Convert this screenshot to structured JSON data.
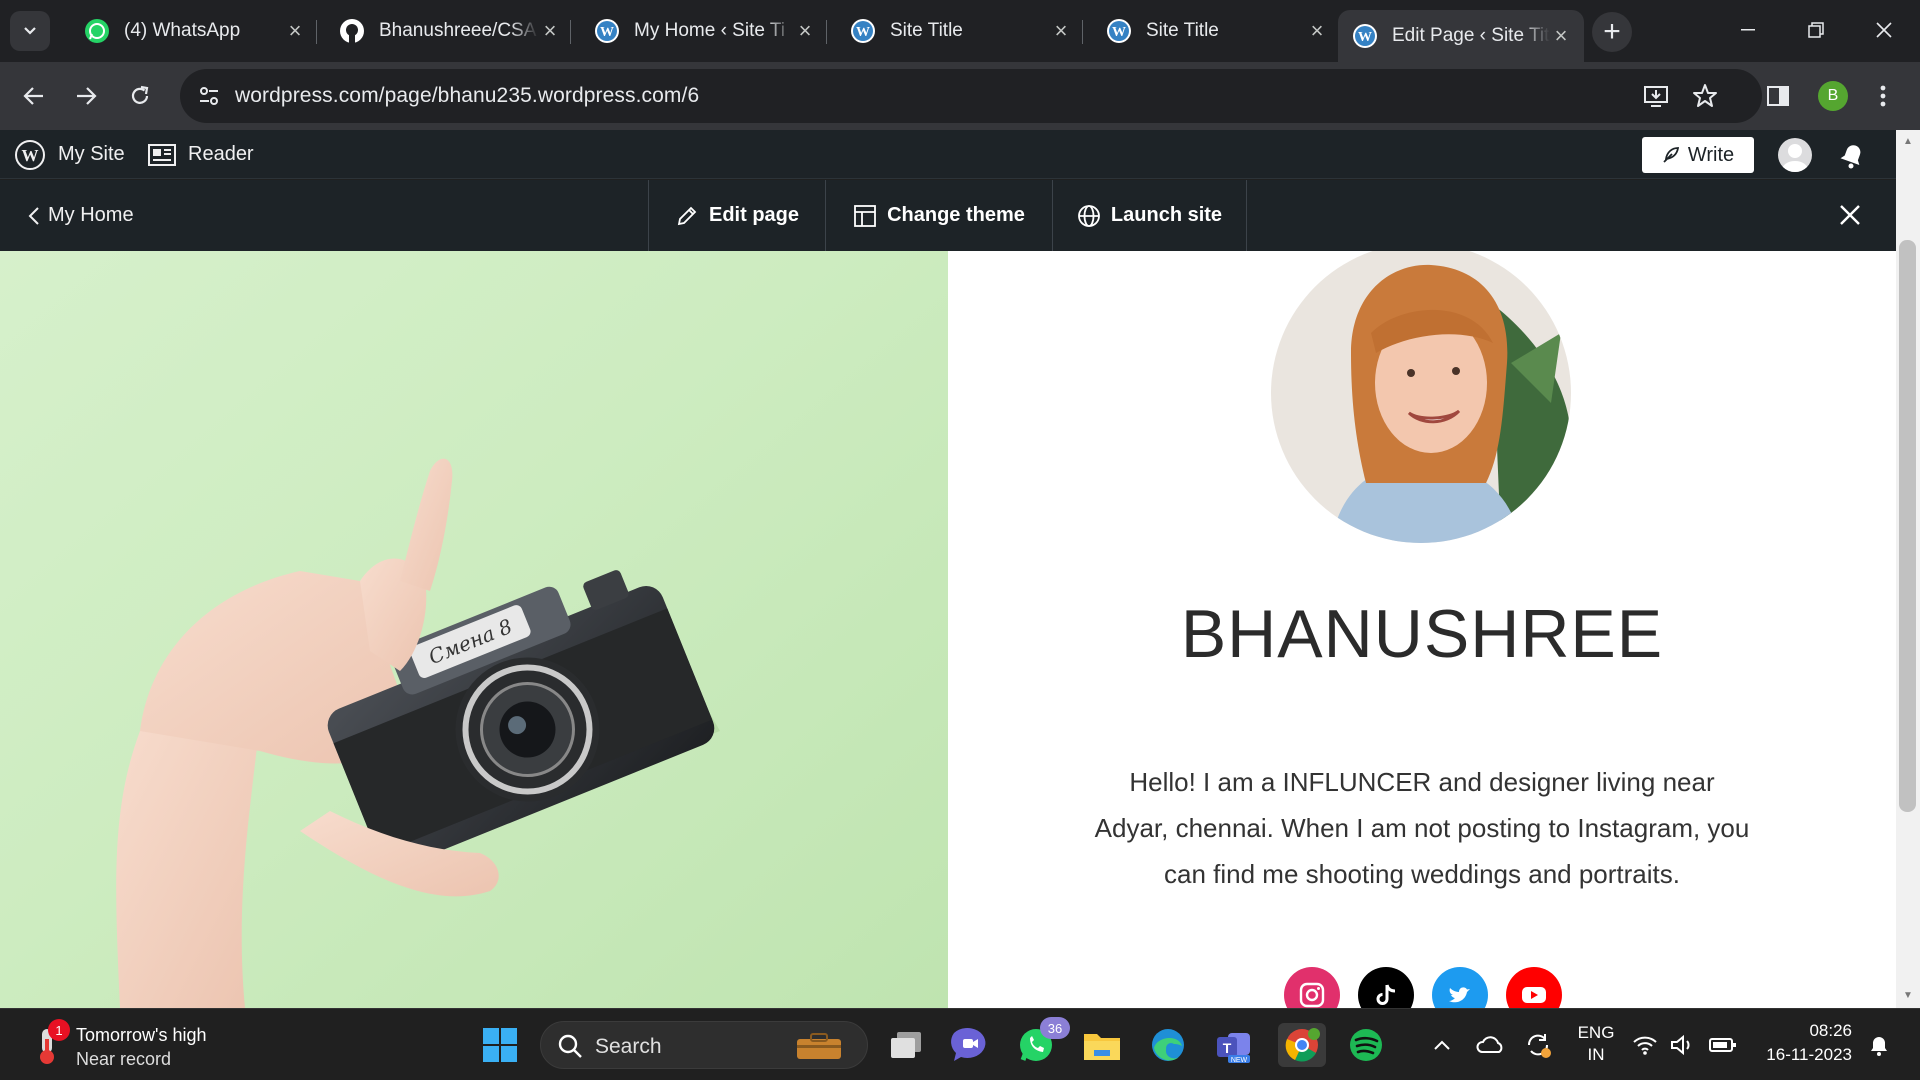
{
  "browser": {
    "tabs": [
      {
        "title": "(4) WhatsApp",
        "icon": "whatsapp-icon",
        "active": false
      },
      {
        "title": "Bhanushreee/CSA",
        "icon": "github-icon",
        "active": false
      },
      {
        "title": "My Home ‹ Site Ti",
        "icon": "wordpress-icon",
        "active": false
      },
      {
        "title": "Site Title",
        "icon": "wordpress-icon",
        "active": false
      },
      {
        "title": "Site Title",
        "icon": "wordpress-icon",
        "active": false
      },
      {
        "title": "Edit Page ‹ Site Tit",
        "icon": "wordpress-icon",
        "active": true
      }
    ],
    "url": "wordpress.com/page/bhanu235.wordpress.com/6",
    "profile_initial": "B"
  },
  "wp_admin": {
    "my_site": "My Site",
    "reader": "Reader",
    "write": "Write"
  },
  "preview_bar": {
    "back": "My Home",
    "edit_page": "Edit page",
    "change_theme": "Change theme",
    "launch_site": "Launch site"
  },
  "page": {
    "site_name": "BHANUSHREE",
    "bio": "Hello! I am a INFLUNCER and designer living near Adyar, chennai. When I am not posting to Instagram, you can find me shooting weddings and portraits.",
    "socials": [
      "instagram-icon",
      "tiktok-icon",
      "twitter-icon",
      "youtube-icon"
    ]
  },
  "taskbar": {
    "weather_line1": "Tomorrow's high",
    "weather_line2": "Near record",
    "weather_badge": "1",
    "search_label": "Search",
    "whatsapp_badge": "36",
    "lang_line1": "ENG",
    "lang_line2": "IN",
    "time": "08:26",
    "date": "16-11-2023"
  },
  "colors": {
    "wp_dark": "#1d2327",
    "chrome_dark": "#202124",
    "chrome_mid": "#35363a",
    "instagram": "#e1306c",
    "twitter": "#1d9bf0",
    "youtube": "#ff0000"
  }
}
